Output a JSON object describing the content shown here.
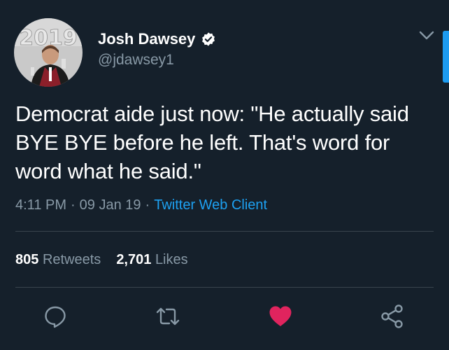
{
  "author": {
    "display_name": "Josh Dawsey",
    "handle": "@jdawsey1",
    "avatar_icon": "profile-photo",
    "verified_icon": "verified-badge-icon"
  },
  "tweet": {
    "text": "Democrat aide just now: \"He actually said BYE BYE before he left. That's word for word what he said.\"",
    "time": "4:11 PM",
    "separator": "·",
    "date": "09 Jan 19",
    "client": "Twitter Web Client"
  },
  "stats": {
    "retweets_count": "805",
    "retweets_label": "Retweets",
    "likes_count": "2,701",
    "likes_label": "Likes"
  },
  "actions": {
    "reply_icon": "reply-icon",
    "retweet_icon": "retweet-icon",
    "like_icon": "heart-icon",
    "share_icon": "share-icon"
  },
  "colors": {
    "background": "#15202b",
    "secondary_text": "#8899a6",
    "link": "#1da1f2",
    "like": "#e0245e",
    "divider": "#38444d"
  }
}
